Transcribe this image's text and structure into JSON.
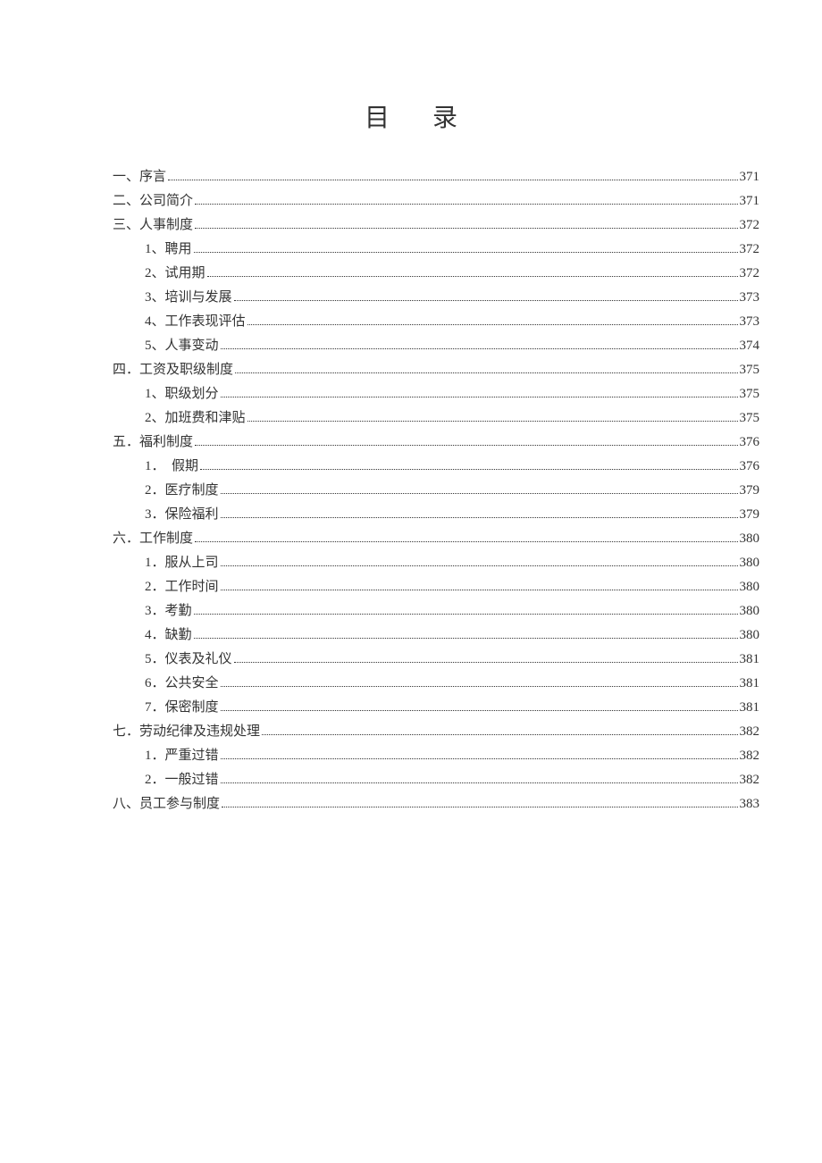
{
  "title": "目录",
  "toc": [
    {
      "level": 1,
      "label": "一、序言",
      "page": "371"
    },
    {
      "level": 1,
      "label": "二、公司简介",
      "page": "371"
    },
    {
      "level": 1,
      "label": "三、人事制度",
      "page": "372"
    },
    {
      "level": 2,
      "label": "1、聘用",
      "page": "372"
    },
    {
      "level": 2,
      "label": "2、试用期",
      "page": "372"
    },
    {
      "level": 2,
      "label": "3、培训与发展",
      "page": "373"
    },
    {
      "level": 2,
      "label": "4、工作表现评估",
      "page": "373"
    },
    {
      "level": 2,
      "label": "5、人事变动",
      "page": "374"
    },
    {
      "level": 1,
      "label": "四．工资及职级制度",
      "page": "375"
    },
    {
      "level": 2,
      "label": "1、职级划分",
      "page": "375"
    },
    {
      "level": 2,
      "label": "2、加班费和津贴",
      "page": "375"
    },
    {
      "level": 1,
      "label": "五．福利制度",
      "page": "376"
    },
    {
      "level": 2,
      "label": "1．　假期",
      "page": "376"
    },
    {
      "level": 2,
      "label": "2．医疗制度",
      "page": "379"
    },
    {
      "level": 2,
      "label": "3．保险福利",
      "page": "379"
    },
    {
      "level": 1,
      "label": "六．工作制度",
      "page": "380"
    },
    {
      "level": 2,
      "label": "1．服从上司",
      "page": "380"
    },
    {
      "level": 2,
      "label": "2．工作时间",
      "page": "380"
    },
    {
      "level": 2,
      "label": "3．考勤",
      "page": "380"
    },
    {
      "level": 2,
      "label": "4．缺勤",
      "page": "380"
    },
    {
      "level": 2,
      "label": "5．仪表及礼仪",
      "page": "381"
    },
    {
      "level": 2,
      "label": "6．公共安全",
      "page": "381"
    },
    {
      "level": 2,
      "label": "7．保密制度",
      "page": "381"
    },
    {
      "level": 1,
      "label": "七．劳动纪律及违规处理",
      "page": "382"
    },
    {
      "level": 2,
      "label": "1．严重过错",
      "page": "382"
    },
    {
      "level": 2,
      "label": "2．一般过错",
      "page": "382"
    },
    {
      "level": 1,
      "label": "八、员工参与制度",
      "page": "383"
    }
  ]
}
